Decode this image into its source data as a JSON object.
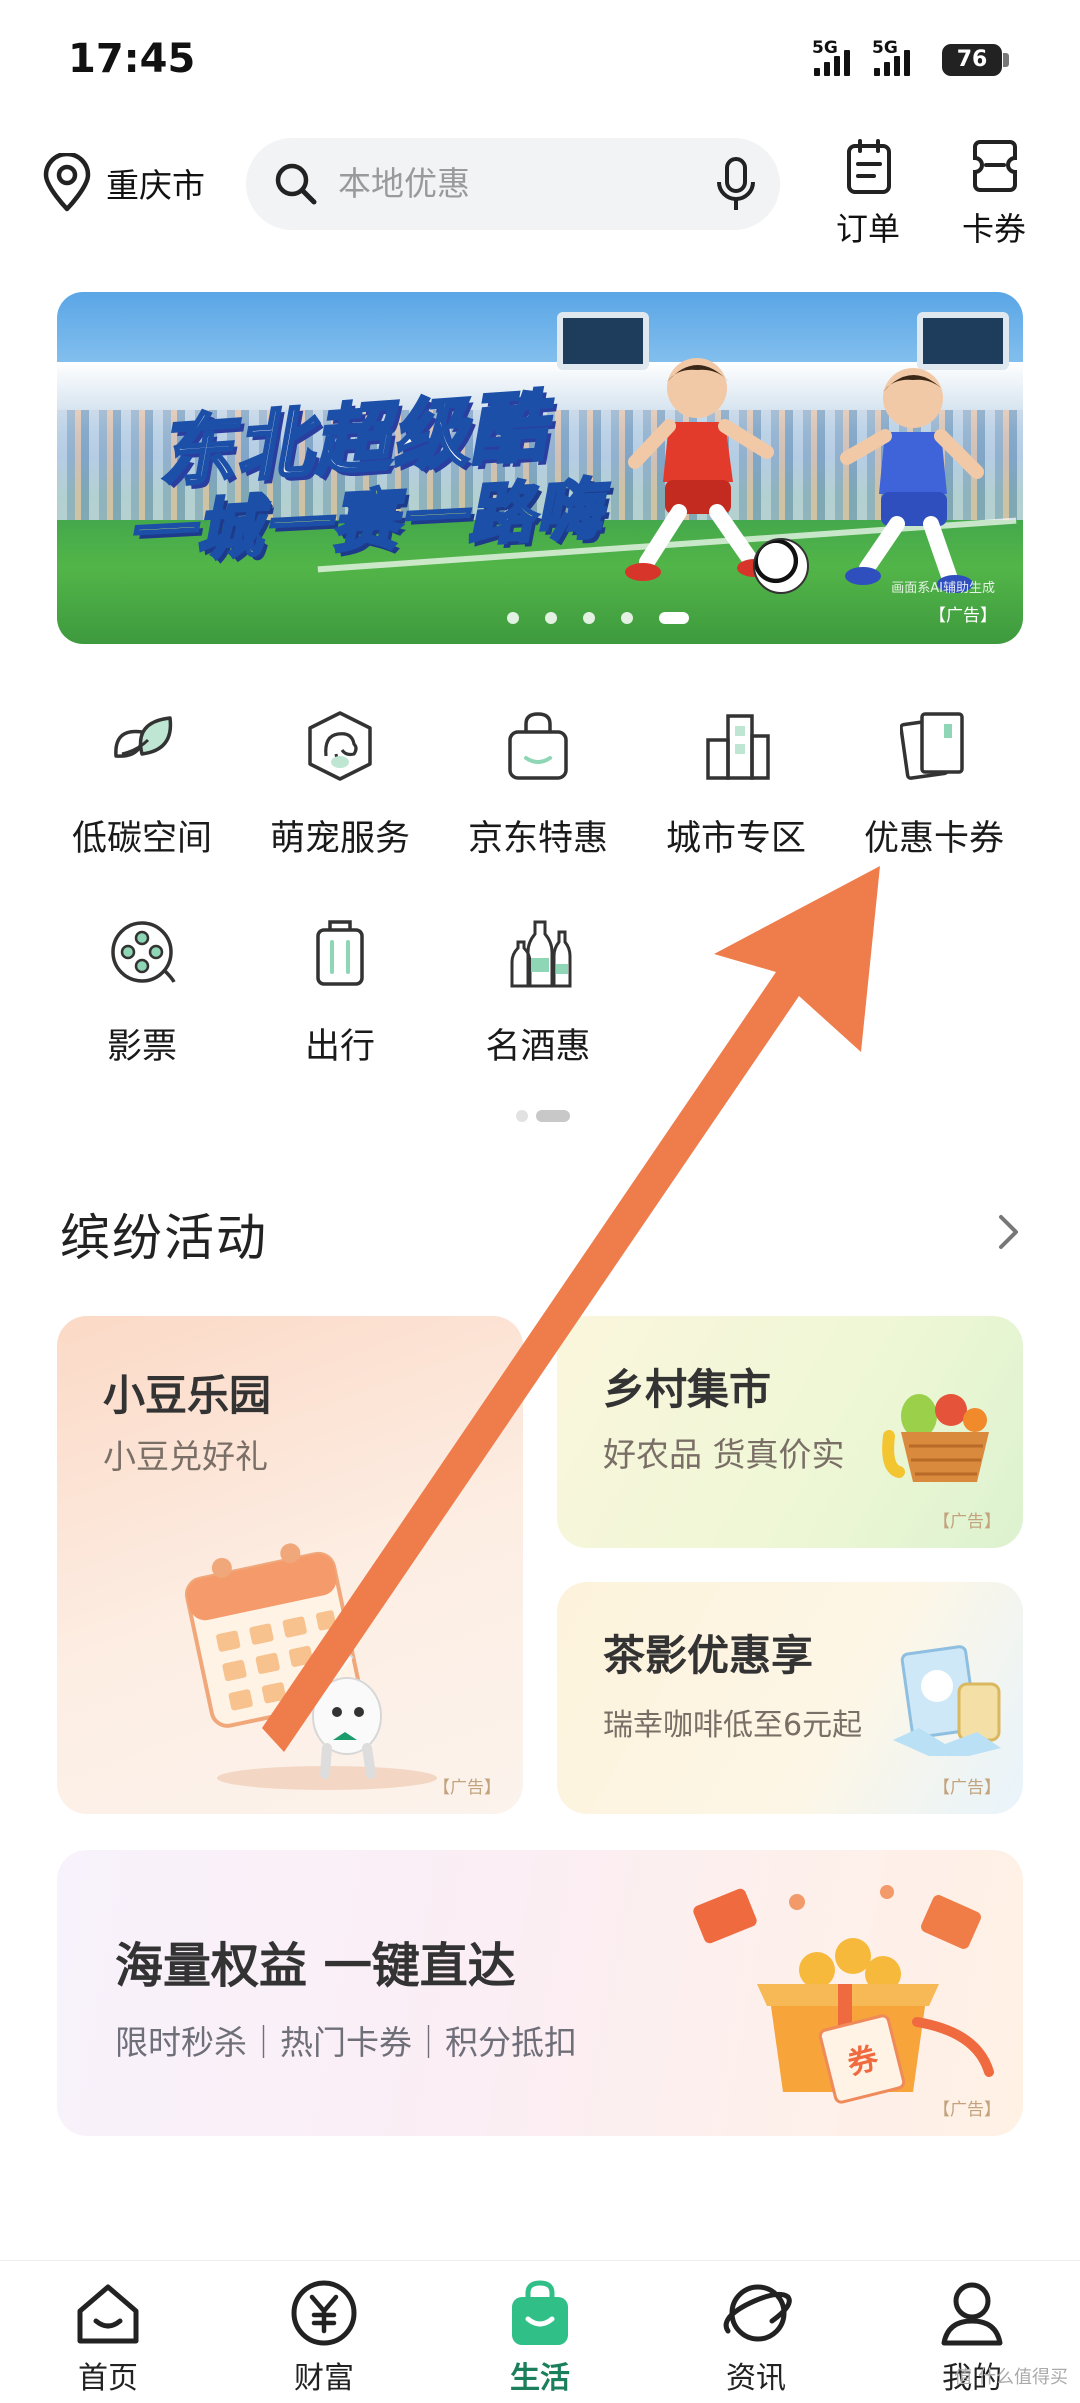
{
  "status_bar": {
    "time": "17:45",
    "sim1": "5G",
    "sim2": "5G",
    "battery": "76"
  },
  "header": {
    "city": "重庆市",
    "search_placeholder": "本地优惠",
    "orders_label": "订单",
    "coupons_label": "卡券"
  },
  "banner": {
    "title_line1": "东北超级酷",
    "title_line2": "一城一赛一路嗨",
    "note": "画面系AI辅助生成",
    "ad_tag": "【广告】",
    "slide_count": 5,
    "active_slide": 5
  },
  "services": {
    "items": [
      {
        "label": "低碳空间",
        "icon": "leaf-icon"
      },
      {
        "label": "萌宠服务",
        "icon": "pet-icon"
      },
      {
        "label": "京东特惠",
        "icon": "shopping-bag-icon"
      },
      {
        "label": "城市专区",
        "icon": "city-buildings-icon"
      },
      {
        "label": "优惠卡券",
        "icon": "coupon-cards-icon"
      },
      {
        "label": "影票",
        "icon": "film-reel-icon"
      },
      {
        "label": "出行",
        "icon": "luggage-icon"
      },
      {
        "label": "名酒惠",
        "icon": "wine-bottles-icon"
      }
    ],
    "page_count": 2,
    "active_page": 2
  },
  "activities": {
    "title": "缤纷活动",
    "park": {
      "title": "小豆乐园",
      "subtitle": "小豆兑好礼",
      "ad_tag": "【广告】"
    },
    "market": {
      "title": "乡村集市",
      "subtitle": "好农品 货真价实",
      "ad_tag": "【广告】"
    },
    "tea": {
      "title": "茶影优惠享",
      "subtitle": "瑞幸咖啡低至6元起",
      "ad_tag": "【广告】"
    },
    "rights": {
      "title": "海量权益 一键直达",
      "subtitle": "限时秒杀｜热门卡券｜积分抵扣",
      "ad_tag": "【广告】",
      "coupon_glyph": "券"
    }
  },
  "annotation": {
    "arrow_color": "#ef7d4c"
  },
  "bottom_nav": {
    "items": [
      {
        "label": "首页",
        "icon": "home-icon"
      },
      {
        "label": "财富",
        "icon": "yen-icon"
      },
      {
        "label": "生活",
        "icon": "shopping-bag-icon"
      },
      {
        "label": "资讯",
        "icon": "planet-icon"
      },
      {
        "label": "我的",
        "icon": "profile-icon"
      }
    ],
    "active": "生活",
    "watermark": "值 什么值得买"
  },
  "colors": {
    "brand_green": "#1b7f5c",
    "active_tab_green": "#2fbf87",
    "icon_stroke": "#333333"
  }
}
